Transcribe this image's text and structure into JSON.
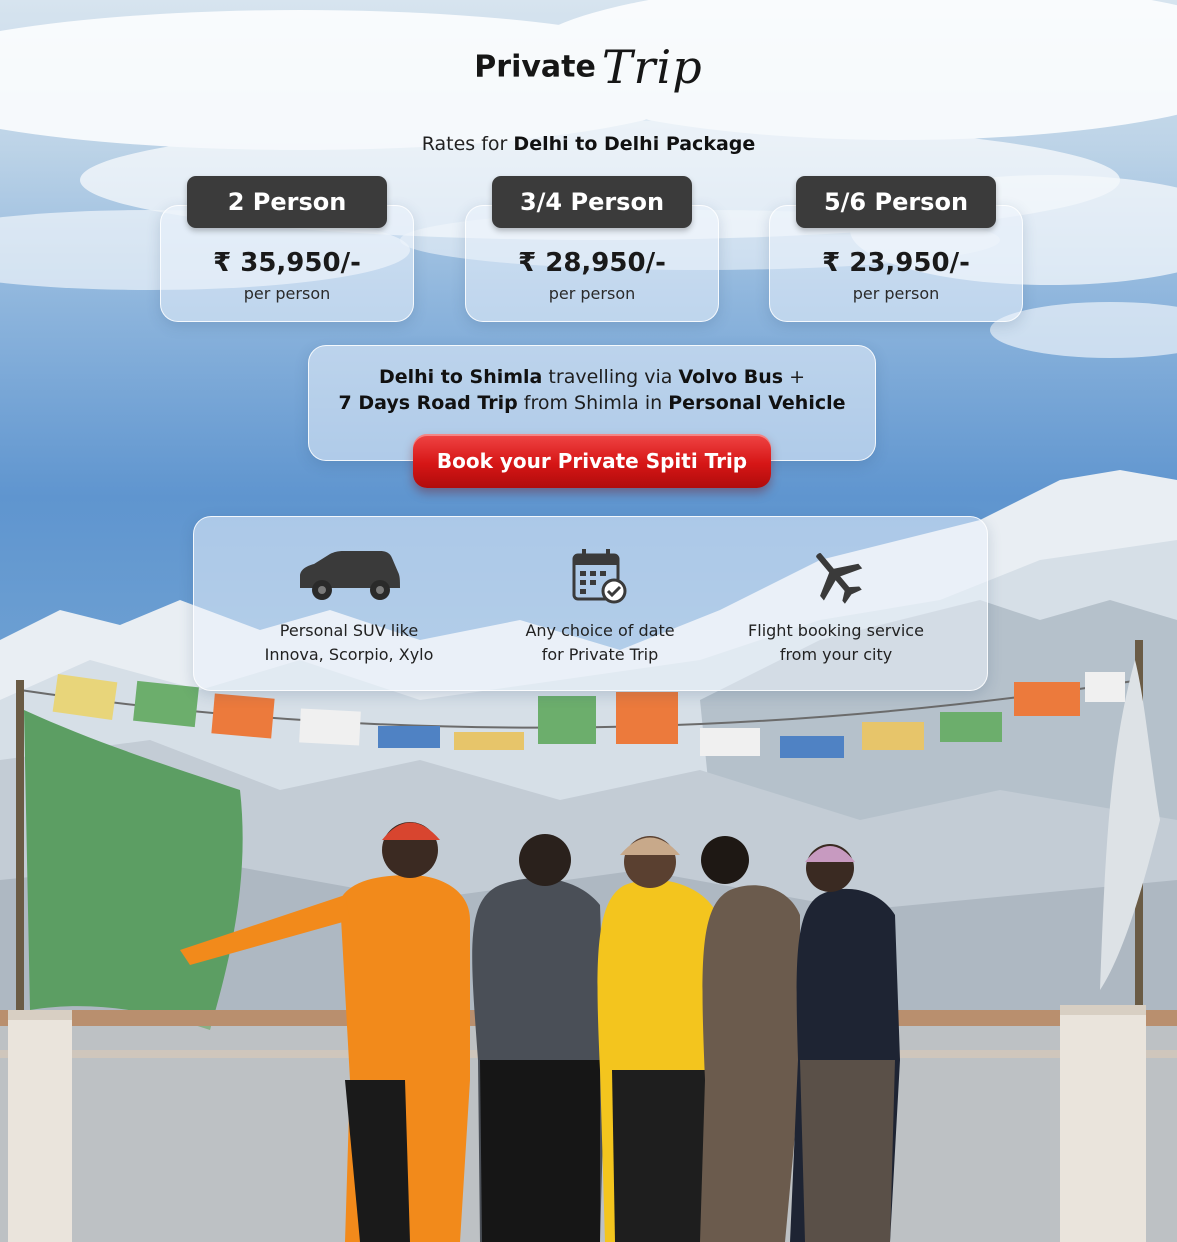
{
  "header": {
    "title_main": "Private",
    "title_script": "Trip"
  },
  "subtitle": {
    "prefix": "Rates for",
    "bold": "Delhi to Delhi Package"
  },
  "pricing": [
    {
      "label": "2 Person",
      "price": "₹ 35,950/-",
      "unit": "per person"
    },
    {
      "label": "3/4 Person",
      "price": "₹ 28,950/-",
      "unit": "per person"
    },
    {
      "label": "5/6 Person",
      "price": "₹ 23,950/-",
      "unit": "per person"
    }
  ],
  "route": {
    "line1": {
      "a": "Delhi to Shimla",
      "b": " travelling via ",
      "c": "Volvo Bus",
      "d": "  +"
    },
    "line2": {
      "a": "7 Days Road Trip",
      "b": " from Shimla in ",
      "c": "Personal Vehicle"
    }
  },
  "cta": {
    "label": "Book your Private Spiti Trip"
  },
  "features": [
    {
      "icon": "car-icon",
      "line1": "Personal SUV like",
      "line2": "Innova, Scorpio, Xylo"
    },
    {
      "icon": "calendar-check-icon",
      "line1": "Any choice of date",
      "line2": "for Private Trip"
    },
    {
      "icon": "airplane-icon",
      "line1": "Flight booking service",
      "line2": "from your city"
    }
  ],
  "colors": {
    "tag": "#3b3b3b",
    "cta": "#d61616",
    "text": "#1a1a1a"
  }
}
